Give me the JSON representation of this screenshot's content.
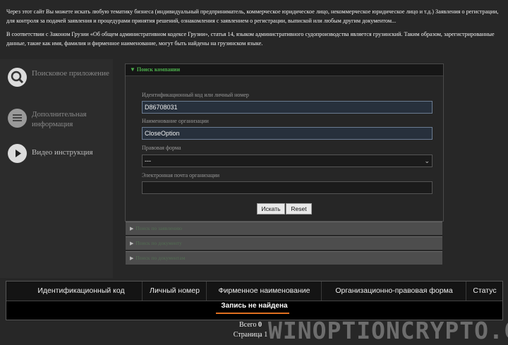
{
  "intro": {
    "paragraph1": "Через этот сайт Вы можете искать любую тематику бизнеса (индивидуальный предприниматель, коммерческое юридическое лицо, некоммерческое юридическое лицо и т.д.) Заявления о регистрации, для контроля за подачей заявления и процедурами принятия решений, ознакомления с заявлением о регистрации, выпиской или любым другим документом...",
    "paragraph2": "В соответствии с Законом Грузии «Об общем административном кодексе Грузии», статья 14, языком административного судопроизводства является грузинский. Таким образом, зарегистрированные данные, такие как имя, фамилия и фирменное наименование, могут быть найдены на грузинском языке."
  },
  "sidebar": {
    "items": [
      {
        "label": "Поисковое приложение",
        "icon": "search-icon"
      },
      {
        "label": "Дополнительная информация",
        "icon": "document-icon"
      },
      {
        "label": "Видео инструкция",
        "icon": "play-icon"
      }
    ]
  },
  "search_panel": {
    "title": "▼ Поиск компании",
    "fields": {
      "id_label": "Идентификационный код или личный номер",
      "id_value": "D86708031",
      "org_label": "Наименование организации",
      "org_value": "CloseOption",
      "legal_form_label": "Правовая форма",
      "legal_form_value": "---",
      "email_label": "Электронная почта организации",
      "email_value": ""
    },
    "search_button": "Искать",
    "reset_button": "Reset"
  },
  "accordions": [
    {
      "label": "Поиск по заявлению"
    },
    {
      "label": "Поиск по документу"
    },
    {
      "label": "Поиск по документам"
    }
  ],
  "results_table": {
    "columns": [
      "Идентификационный код",
      "Личный номер",
      "Фирменное наименование",
      "Организационно-правовая форма",
      "Статус"
    ],
    "empty_message": "Запись не найдена"
  },
  "footer": {
    "total_label": "Всего",
    "total_value": "0",
    "page_label": "Страница 1"
  },
  "watermark": "WINOPTIONCRYPTO.COM",
  "colors": {
    "background": "#272727",
    "accent_green": "#4caf4c",
    "underline_orange": "#e07020"
  }
}
